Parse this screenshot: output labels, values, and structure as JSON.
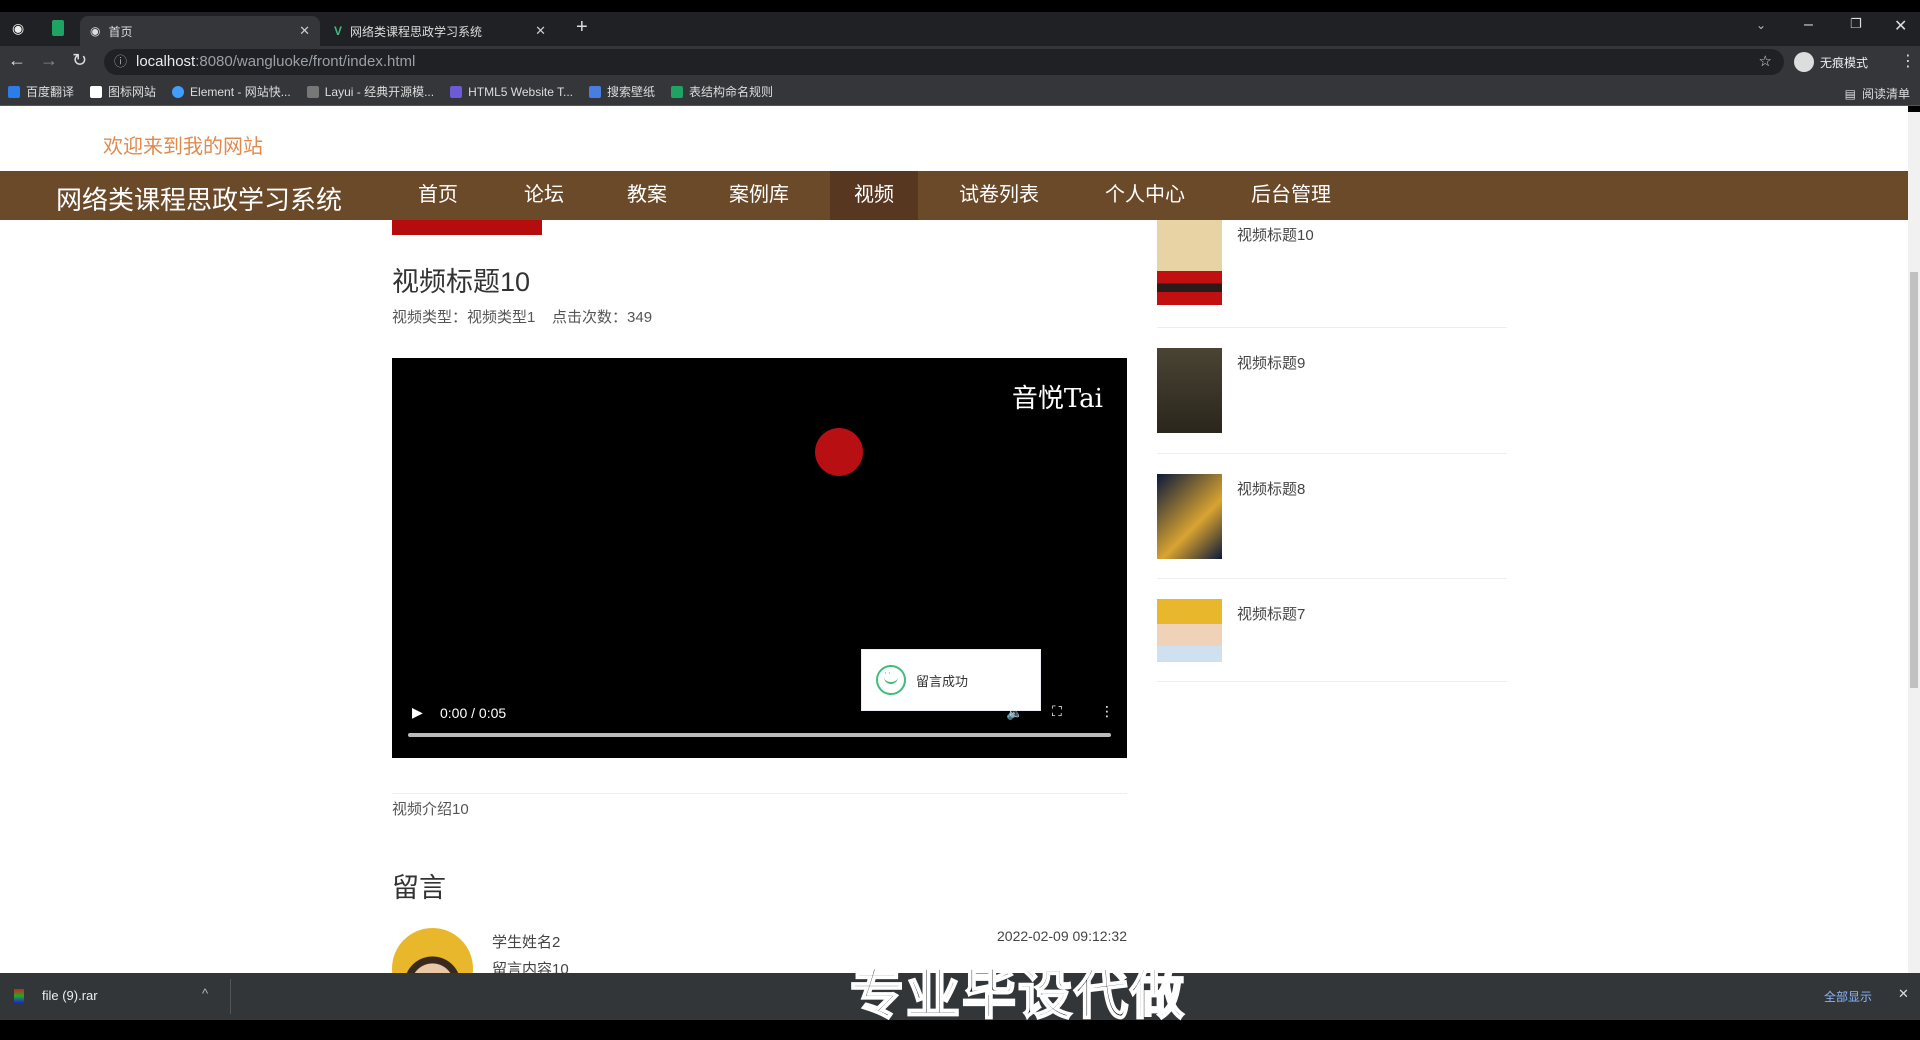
{
  "browser": {
    "tabs": [
      {
        "label": "首页",
        "active": true
      },
      {
        "label": "网络类课程思政学习系统",
        "active": false
      }
    ],
    "url_host": "localhost",
    "url_rest": ":8080/wangluoke/front/index.html",
    "profile_label": "无痕模式",
    "bookmarks": [
      "百度翻译",
      "图标网站",
      "Element - 网站快...",
      "Layui - 经典开源模...",
      "HTML5 Website T...",
      "搜索壁纸",
      "表结构命名规则"
    ],
    "reading_list": "阅读清单"
  },
  "site": {
    "welcome": "欢迎来到我的网站",
    "brand": "网络类课程思政学习系统",
    "nav": [
      "首页",
      "论坛",
      "教案",
      "案例库",
      "视频",
      "试卷列表",
      "个人中心",
      "后台管理"
    ],
    "active_nav": "视频",
    "brand_color": "#6b4a2a"
  },
  "video": {
    "title": "视频标题10",
    "type_label": "视频类型：",
    "type_value": "视频类型1",
    "clicks_label": "点击次数：",
    "clicks_value": "349",
    "watermark": "音悦Tai",
    "time": "0:00 / 0:05",
    "intro": "视频介绍10"
  },
  "toast": {
    "message": "留言成功"
  },
  "comments": {
    "heading": "留言",
    "items": [
      {
        "name": "学生姓名2",
        "content": "留言内容10",
        "date": "2022-02-09 09:12:32"
      }
    ]
  },
  "sidebar": {
    "items": [
      {
        "title": "视频标题10"
      },
      {
        "title": "视频标题9"
      },
      {
        "title": "视频标题8"
      },
      {
        "title": "视频标题7"
      }
    ]
  },
  "download": {
    "file": "file (9).rar",
    "show_all": "全部显示"
  },
  "overlay": {
    "subtitle": "专业毕设代做"
  }
}
